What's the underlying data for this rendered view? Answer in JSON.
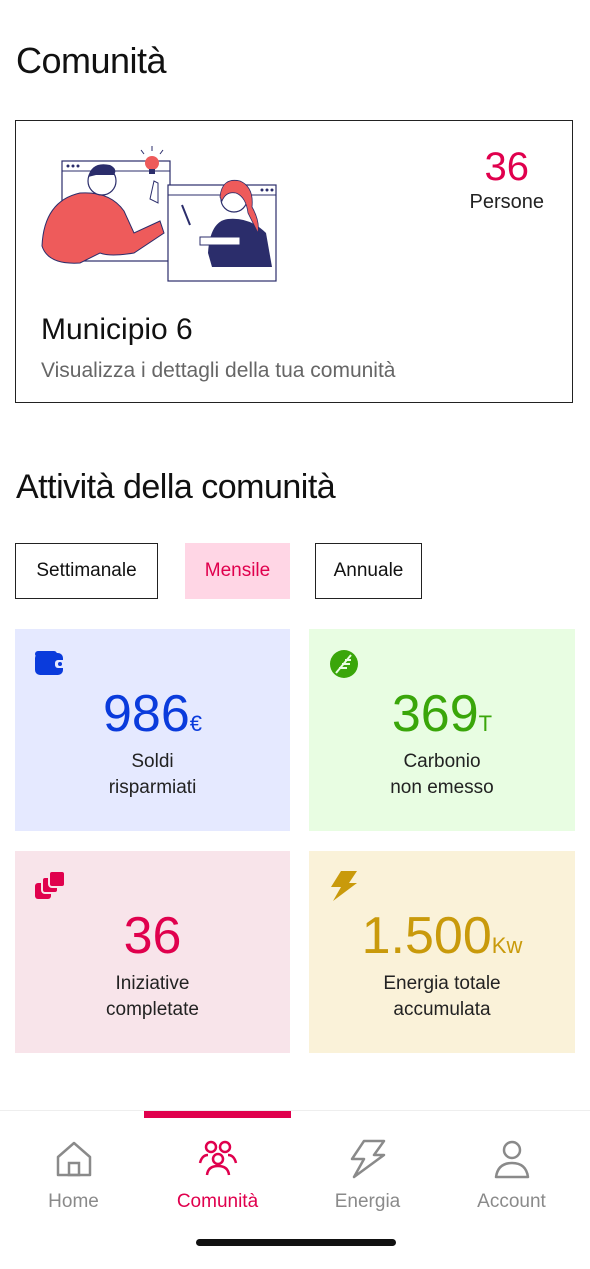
{
  "header": {
    "title": "Comunità"
  },
  "community_card": {
    "people_count": "36",
    "people_label": "Persone",
    "name": "Municipio 6",
    "subtitle": "Visualizza i dettagli della tua comunità"
  },
  "activity": {
    "title": "Attività della comunità",
    "filters": [
      {
        "label": "Settimanale",
        "active": false
      },
      {
        "label": "Mensile",
        "active": true
      },
      {
        "label": "Annuale",
        "active": false
      }
    ],
    "stats": [
      {
        "icon": "wallet-icon",
        "value": "986",
        "unit": "€",
        "line1": "Soldi",
        "line2": "risparmiati",
        "color": "#0a3bdc",
        "bg": "#e5e9ff"
      },
      {
        "icon": "leaf-icon",
        "value": "369",
        "unit": "T",
        "line1": "Carbonio",
        "line2": "non emesso",
        "color": "#3aa60a",
        "bg": "#e8fde2"
      },
      {
        "icon": "stack-icon",
        "value": "36",
        "unit": "",
        "line1": "Iniziative",
        "line2": "completate",
        "color": "#e0004d",
        "bg": "#f8e4ea"
      },
      {
        "icon": "lightning-icon",
        "value": "1.500",
        "unit": "Kw",
        "line1": "Energia totale",
        "line2": "accumulata",
        "color": "#c99a0b",
        "bg": "#faf2d9"
      }
    ]
  },
  "tabbar": {
    "tabs": [
      {
        "label": "Home",
        "icon": "home-icon",
        "active": false
      },
      {
        "label": "Comunità",
        "icon": "people-icon",
        "active": true
      },
      {
        "label": "Energia",
        "icon": "lightning-icon",
        "active": false
      },
      {
        "label": "Account",
        "icon": "user-icon",
        "active": false
      }
    ]
  },
  "colors": {
    "accent": "#e0004d",
    "inactive": "#8a8a8a"
  }
}
